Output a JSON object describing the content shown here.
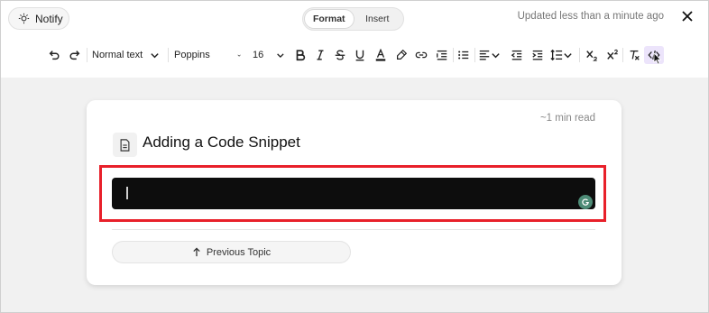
{
  "header": {
    "notify_label": "Notify",
    "tabs": [
      {
        "label": "Format",
        "active": true
      },
      {
        "label": "Insert",
        "active": false
      }
    ],
    "status_text": "Updated less than a minute ago"
  },
  "toolbar": {
    "text_style": "Normal text",
    "font_family": "Poppins",
    "font_size": "16",
    "icons": [
      "undo-icon",
      "redo-icon",
      "bold-icon",
      "italic-icon",
      "strikethrough-icon",
      "underline-icon",
      "text-color-icon",
      "highlight-icon",
      "link-icon",
      "indent-icon",
      "bullet-list-icon",
      "align-icon",
      "outdent-icon",
      "indent-increase-icon",
      "line-height-icon",
      "subscript-icon",
      "superscript-icon",
      "clear-format-icon",
      "code-icon"
    ],
    "active_tool": "code-icon",
    "accent_color": "#ece4fb"
  },
  "document": {
    "read_time": "~1 min read",
    "title": "Adding a Code Snippet",
    "code_content": "",
    "prev_label": "Previous Topic"
  },
  "colors": {
    "highlight_border": "#e8202a",
    "code_background": "#0d0d0d",
    "canvas_background": "#f1f1f1"
  }
}
